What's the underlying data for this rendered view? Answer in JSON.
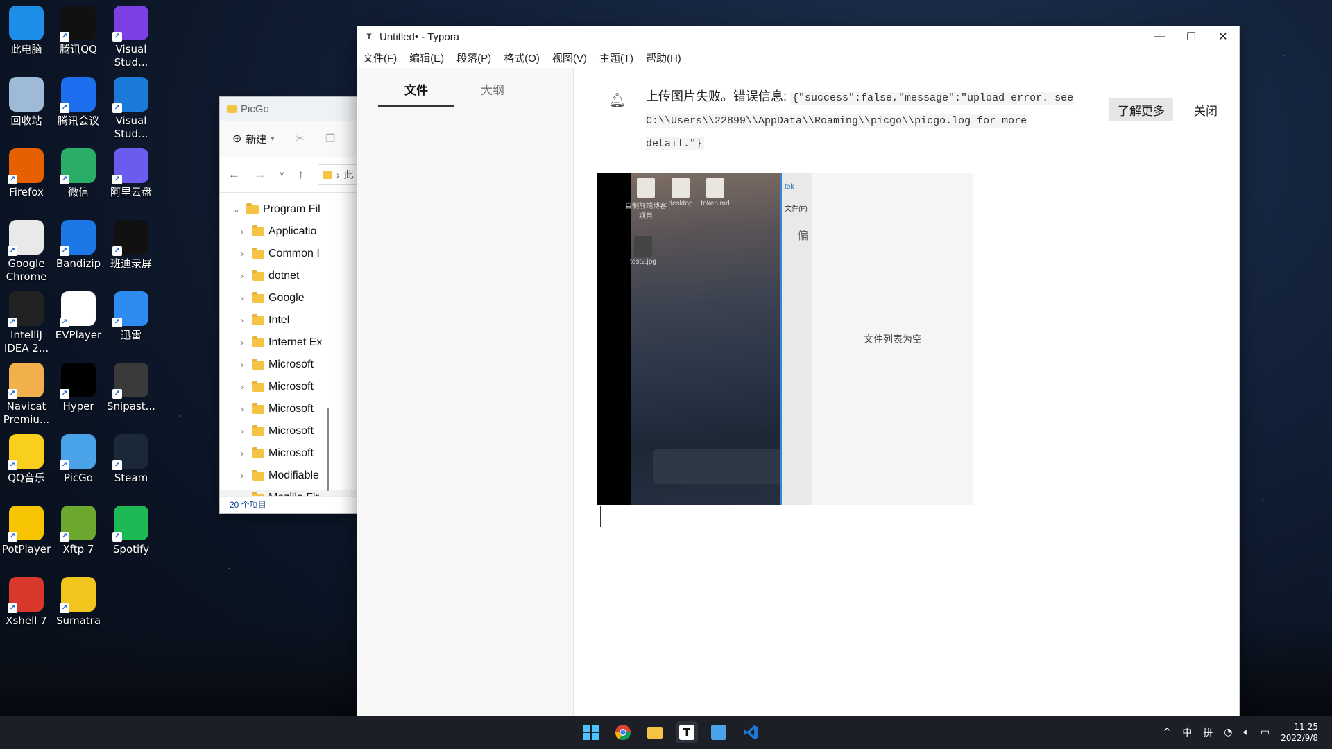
{
  "desktop": {
    "icons": [
      {
        "label": "此电脑",
        "color": "#1d8fe8"
      },
      {
        "label": "腾讯QQ",
        "color": "#111111"
      },
      {
        "label": "Visual Stud...",
        "color": "#7b3fe4"
      },
      {
        "label": "回收站",
        "color": "#9fbad6"
      },
      {
        "label": "腾讯会议",
        "color": "#1e6ef0"
      },
      {
        "label": "Visual Stud...",
        "color": "#1b7ad8"
      },
      {
        "label": "Firefox",
        "color": "#e66000"
      },
      {
        "label": "微信",
        "color": "#2aae67"
      },
      {
        "label": "阿里云盘",
        "color": "#6b5cf0"
      },
      {
        "label": "Google Chrome",
        "color": "#e9e9e9"
      },
      {
        "label": "Bandizip",
        "color": "#1b78e6"
      },
      {
        "label": "班迪录屏",
        "color": "#111111"
      },
      {
        "label": "IntelliJ IDEA 2...",
        "color": "#222222"
      },
      {
        "label": "EVPlayer",
        "color": "#ffffff"
      },
      {
        "label": "迅雷",
        "color": "#2d8cf0"
      },
      {
        "label": "Navicat Premiu...",
        "color": "#f2b04c"
      },
      {
        "label": "Hyper",
        "color": "#000000"
      },
      {
        "label": "Snipast...",
        "color": "#3a3a3a"
      },
      {
        "label": "QQ音乐",
        "color": "#f8cf1d"
      },
      {
        "label": "PicGo",
        "color": "#4aa3e8"
      },
      {
        "label": "Steam",
        "color": "#1b2838"
      },
      {
        "label": "PotPlayer",
        "color": "#f6c400"
      },
      {
        "label": "Xftp 7",
        "color": "#6ca72f"
      },
      {
        "label": "Spotify",
        "color": "#1db954"
      },
      {
        "label": "Xshell 7",
        "color": "#d8382c"
      },
      {
        "label": "Sumatra",
        "color": "#f2c51d"
      }
    ]
  },
  "explorer": {
    "title": "PicGo",
    "new_label": "新建",
    "breadcrumb": "此",
    "tree": [
      {
        "label": "Program Fil",
        "expanded": true,
        "level": 0
      },
      {
        "label": "Applicatio",
        "expanded": false,
        "level": 1
      },
      {
        "label": "Common I",
        "expanded": false,
        "level": 1
      },
      {
        "label": "dotnet",
        "expanded": false,
        "level": 1
      },
      {
        "label": "Google",
        "expanded": false,
        "level": 1
      },
      {
        "label": "Intel",
        "expanded": false,
        "level": 1
      },
      {
        "label": "Internet Ex",
        "expanded": false,
        "level": 1
      },
      {
        "label": "Microsoft",
        "expanded": false,
        "level": 1
      },
      {
        "label": "Microsoft",
        "expanded": false,
        "level": 1
      },
      {
        "label": "Microsoft",
        "expanded": false,
        "level": 1
      },
      {
        "label": "Microsoft",
        "expanded": false,
        "level": 1
      },
      {
        "label": "Microsoft",
        "expanded": false,
        "level": 1
      },
      {
        "label": "Modifiable",
        "expanded": false,
        "level": 1
      },
      {
        "label": "Mozilla Fir",
        "expanded": false,
        "level": 1
      }
    ],
    "status": "20 个项目"
  },
  "typora": {
    "title": "Untitled• - Typora",
    "menu": [
      "文件(F)",
      "编辑(E)",
      "段落(P)",
      "格式(O)",
      "视图(V)",
      "主题(T)",
      "帮助(H)"
    ],
    "tabs": [
      "文件",
      "大纲"
    ],
    "notification": {
      "text": "上传图片失败。错误信息:",
      "code": "{\"success\":false,\"message\":\"upload error. see C:\\\\Users\\\\22899\\\\AppData\\\\Roaming\\\\picgo\\\\picgo.log for more detail.\"}",
      "learn_more": "了解更多",
      "close": "关闭"
    },
    "image": {
      "empty_text": "文件列表为空",
      "files": [
        "自制前端博客项目",
        "desktop",
        "token.md",
        "test2.jpg"
      ],
      "token_tab": "tok",
      "file_menu": "文件(F)",
      "partial": "偏"
    }
  },
  "taskbar": {
    "apps": [
      "start",
      "chrome",
      "explorer",
      "typora",
      "picgo",
      "vscode"
    ],
    "ime_mode": "中",
    "ime": "拼",
    "time": "11:25",
    "date": "2022/9/8"
  }
}
